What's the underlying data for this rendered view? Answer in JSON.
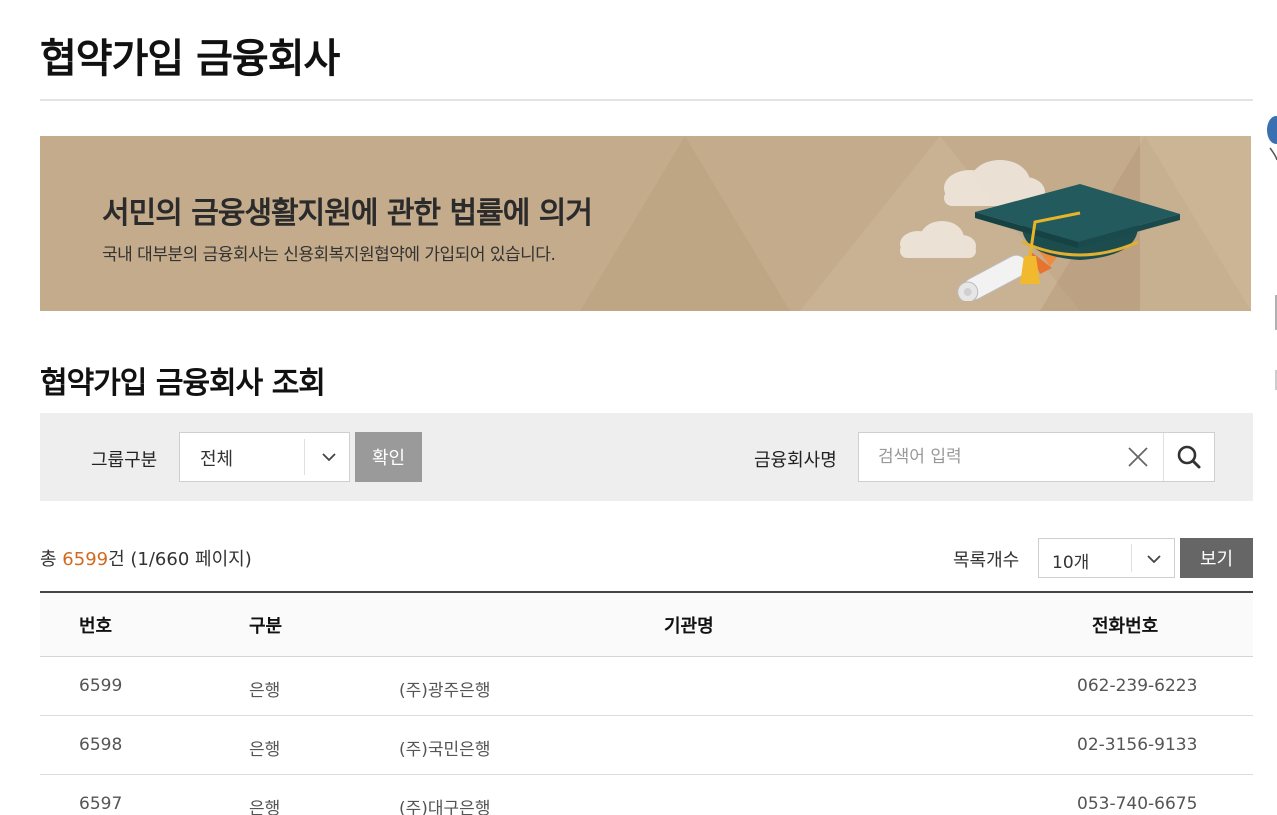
{
  "page": {
    "title": "협약가입 금융회사"
  },
  "banner": {
    "heading": "서민의 금융생활지원에 관한 법률에 의거",
    "subtext": "국내 대부분의 금융회사는 신용회복지원협약에 가입되어 있습니다.",
    "background_color": "#c4ab8b"
  },
  "section": {
    "title": "협약가입 금융회사 조회"
  },
  "search": {
    "group_label": "그룹구분",
    "group_selected": "전체",
    "confirm_label": "확인",
    "name_label": "금융회사명",
    "name_placeholder": "검색어 입력"
  },
  "results": {
    "total_prefix": "총 ",
    "total_count": "6599",
    "total_suffix": "건 (1/660 페이지)",
    "per_page_label": "목록개수",
    "per_page_selected": "10개",
    "view_label": "보기"
  },
  "table": {
    "headers": {
      "no": "번호",
      "type": "구분",
      "name": "기관명",
      "phone": "전화번호"
    },
    "rows": [
      {
        "no": "6599",
        "type": "은행",
        "name": "(주)광주은행",
        "phone": "062-239-6223"
      },
      {
        "no": "6598",
        "type": "은행",
        "name": "(주)국민은행",
        "phone": "02-3156-9133"
      },
      {
        "no": "6597",
        "type": "은행",
        "name": "(주)대구은행",
        "phone": "053-740-6675"
      }
    ]
  },
  "colors": {
    "accent": "#d2691e",
    "header_rule": "#444444",
    "button_gray": "#9a9a9a",
    "button_dark": "#666666"
  },
  "icons": {
    "clear": "close-icon",
    "search": "search-icon",
    "dropdown": "chevron-down-icon",
    "banner_art": "graduation-cap-icon"
  }
}
